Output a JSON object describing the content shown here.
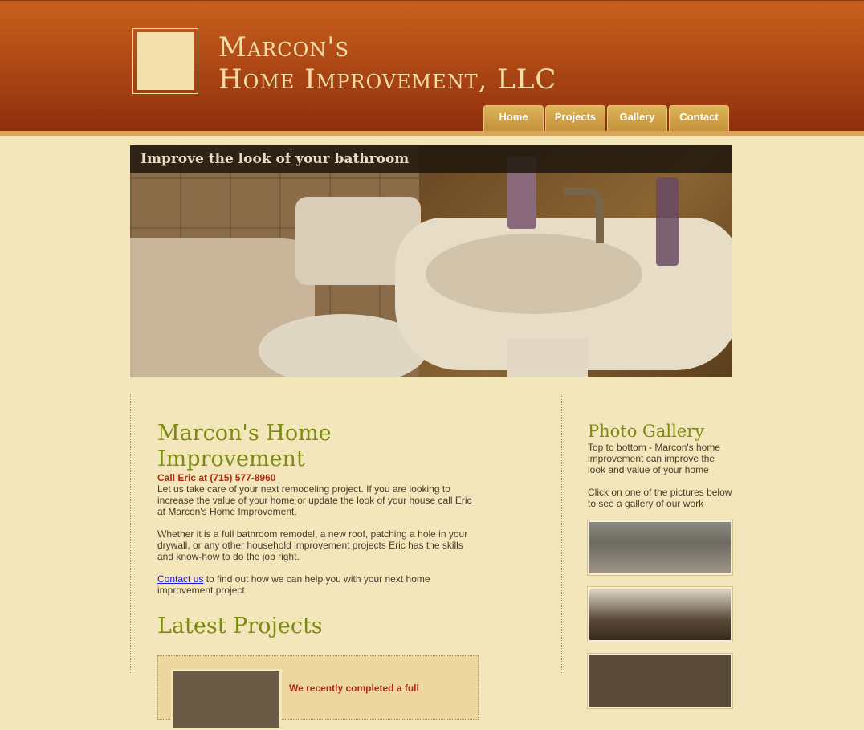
{
  "header": {
    "logo_line1": "Marcon's",
    "logo_line2": "Home Improvement, LLC"
  },
  "nav": {
    "items": [
      {
        "label": "Home"
      },
      {
        "label": "Projects"
      },
      {
        "label": "Gallery"
      },
      {
        "label": "Contact"
      }
    ]
  },
  "hero": {
    "caption": "Improve the look of your bathroom"
  },
  "main": {
    "title": "Marcon's Home Improvement",
    "phone": "Call Eric at (715) 577-8960",
    "para1": "Let us take care of your next remodeling project. If you are looking to increase the value of your home or update the look of your house call Eric at Marcon's Home Improvement.",
    "para2": "Whether it is a full bathroom remodel, a new roof, patching a hole in your drywall, or any other household improvement projects Eric has the skills and know-how to do the job right.",
    "contact_link": "Contact us",
    "contact_rest": " to find out how we can help you with your next home improvement project",
    "latest_title": "Latest Projects",
    "project_text": "We recently completed a full"
  },
  "sidebar": {
    "title": "Photo Gallery",
    "desc1": "Top to bottom - Marcon's home improvement can improve the look and value of your home",
    "desc2": "Click on one of the pictures below to see a gallery of our work"
  }
}
